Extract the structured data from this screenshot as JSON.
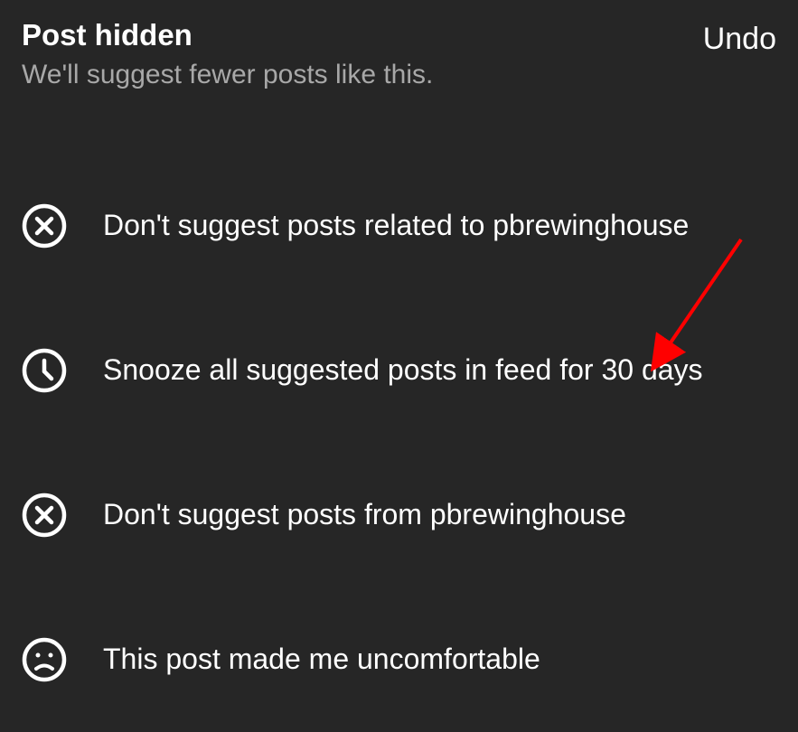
{
  "header": {
    "title": "Post hidden",
    "subtitle": "We'll suggest fewer posts like this.",
    "undo": "Undo"
  },
  "options": [
    {
      "icon": "x-circle-icon",
      "label": "Don't suggest posts related to pbrewinghouse"
    },
    {
      "icon": "clock-icon",
      "label": "Snooze all suggested posts in feed for 30 days"
    },
    {
      "icon": "x-circle-icon",
      "label": "Don't suggest posts from pbrewinghouse"
    },
    {
      "icon": "sad-face-icon",
      "label": "This post made me uncomfortable"
    }
  ]
}
